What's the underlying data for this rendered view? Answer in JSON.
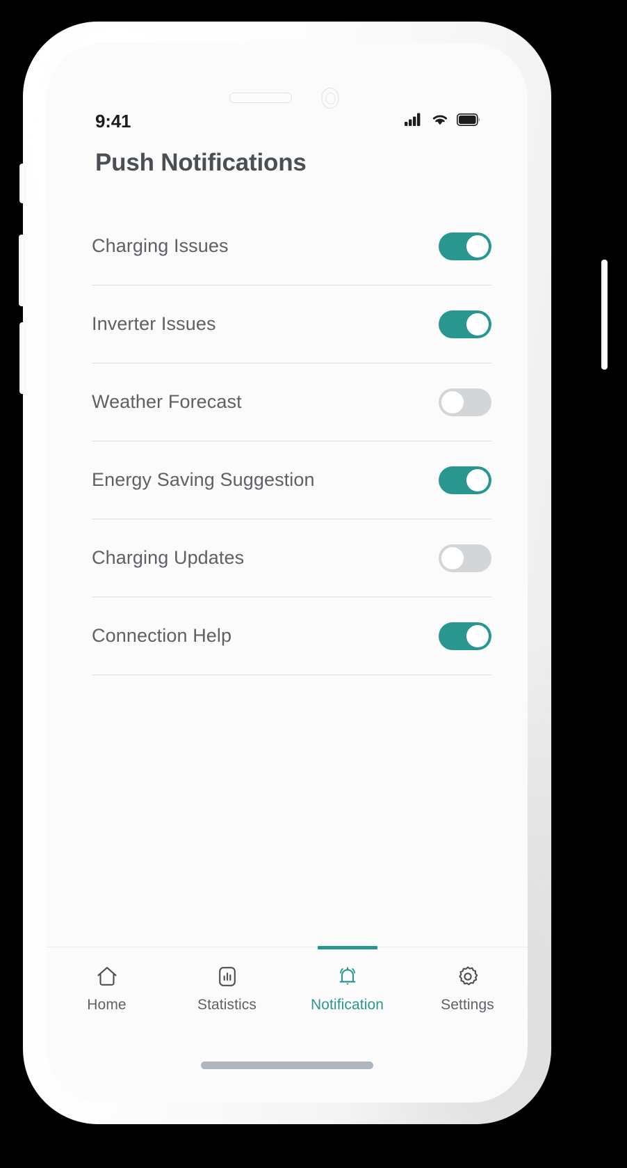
{
  "device": {
    "frame_color": "#ffffff",
    "background": "#000000",
    "screen_background": "#fbfbfb",
    "hardware": {
      "speaker_slot": "speaker-slot",
      "front_camera": "front-camera",
      "silent_switch": "silent-switch-button",
      "volume_up": "volume-up-button",
      "volume_down": "volume-down-button",
      "power": "power-button"
    }
  },
  "theme": {
    "accent": "#2a9690",
    "toggle_on": "#2a9690",
    "toggle_off": "#d3d6d9",
    "knob": "#ffffff",
    "label_text": "#5d6166",
    "title_text": "#4a4f54",
    "separator": "#dedede",
    "home_indicator": "#b0b6bf"
  },
  "status_bar": {
    "time": "9:41",
    "cellular_icon": "cellular-signal-icon",
    "wifi_icon": "wifi-icon",
    "battery_icon": "battery-icon"
  },
  "header": {
    "title": "Push Notifications"
  },
  "settings": {
    "rows": [
      {
        "label": "Charging Issues",
        "enabled": true,
        "state_text": "On"
      },
      {
        "label": "Inverter Issues",
        "enabled": true,
        "state_text": "On"
      },
      {
        "label": "Weather Forecast",
        "enabled": false,
        "state_text": "Off"
      },
      {
        "label": "Energy Saving Suggestion",
        "enabled": true,
        "state_text": "On"
      },
      {
        "label": "Charging Updates",
        "enabled": false,
        "state_text": "Off"
      },
      {
        "label": "Connection Help",
        "enabled": true,
        "state_text": "On"
      }
    ]
  },
  "tab_bar": {
    "active_index": 2,
    "tabs": [
      {
        "label": "Home",
        "icon": "home-icon",
        "active": false
      },
      {
        "label": "Statistics",
        "icon": "bar-chart-icon",
        "active": false
      },
      {
        "label": "Notification",
        "icon": "bell-ringing-icon",
        "active": true
      },
      {
        "label": "Settings",
        "icon": "gear-icon",
        "active": false
      }
    ]
  }
}
